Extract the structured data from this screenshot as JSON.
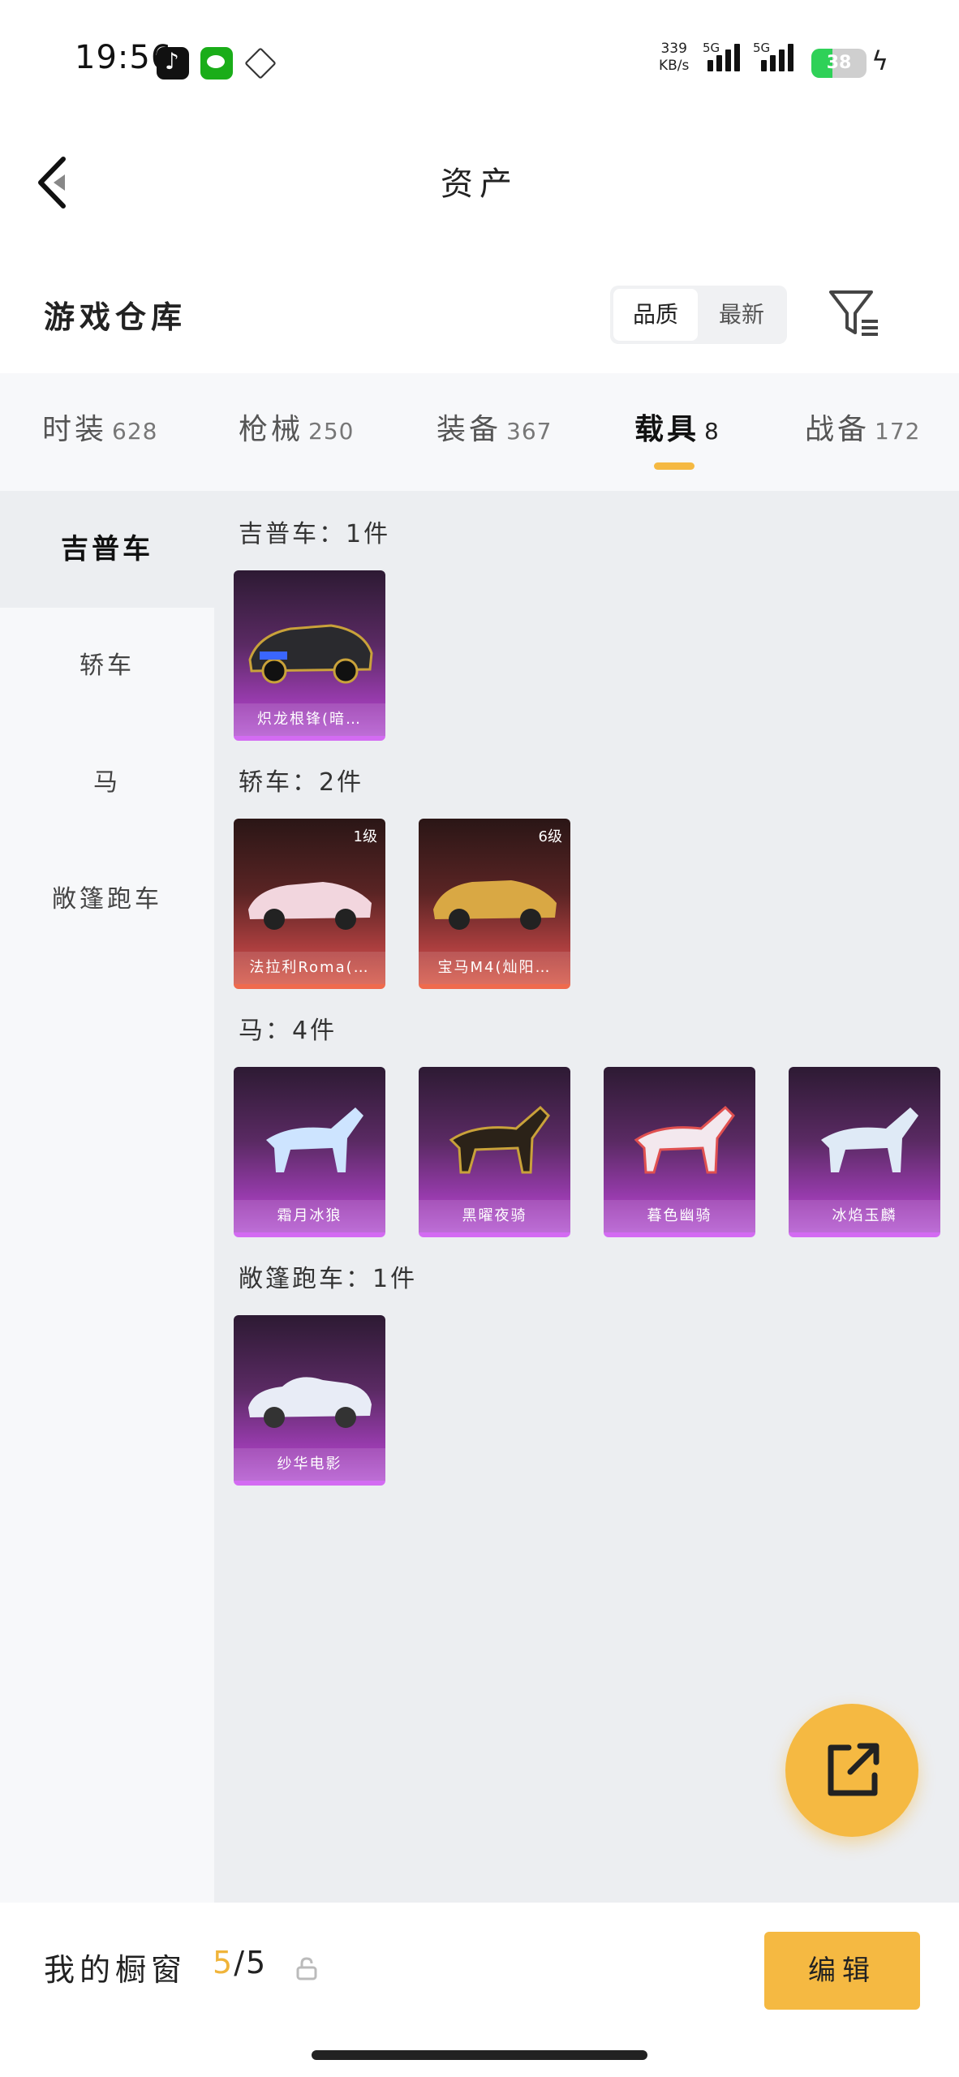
{
  "status_bar": {
    "time": "19:56",
    "net_speed_value": "339",
    "net_speed_unit": "KB/s",
    "signal1_label": "5G",
    "signal2_label": "5G",
    "battery": "38",
    "battery_level": 0.38,
    "apps": [
      "tiktok-icon",
      "wechat-icon",
      "diamond-app-icon"
    ]
  },
  "header": {
    "title": "资产",
    "back_icon": "back-arrow-icon"
  },
  "section": {
    "title": "游戏仓库",
    "sort_options": [
      "品质",
      "最新"
    ],
    "sort_selected": "品质",
    "filter_icon": "filter-icon"
  },
  "tabs": [
    {
      "label": "时装",
      "count": "628"
    },
    {
      "label": "枪械",
      "count": "250"
    },
    {
      "label": "装备",
      "count": "367"
    },
    {
      "label": "载具",
      "count": "8"
    },
    {
      "label": "战备",
      "count": "172"
    }
  ],
  "active_tab": "载具",
  "sidebar": {
    "items": [
      "吉普车",
      "轿车",
      "马",
      "敞篷跑车"
    ],
    "active": "吉普车"
  },
  "groups": [
    {
      "title": "吉普车：1件",
      "items": [
        {
          "name": "炽龙根锋(暗…",
          "level": "",
          "style": "purple"
        }
      ]
    },
    {
      "title": "轿车：2件",
      "items": [
        {
          "name": "法拉利Roma(…",
          "level": "1级",
          "style": "red"
        },
        {
          "name": "宝马M4(灿阳…",
          "level": "6级",
          "style": "red"
        }
      ]
    },
    {
      "title": "马：4件",
      "items": [
        {
          "name": "霜月冰狼",
          "level": "",
          "style": "purple"
        },
        {
          "name": "黑曜夜骑",
          "level": "",
          "style": "purple"
        },
        {
          "name": "暮色幽骑",
          "level": "",
          "style": "purple"
        },
        {
          "name": "冰焰玉麟",
          "level": "",
          "style": "purple"
        }
      ]
    },
    {
      "title": "敞篷跑车：1件",
      "items": [
        {
          "name": "纱华电影",
          "level": "",
          "style": "purple"
        }
      ]
    }
  ],
  "fab": {
    "icon": "share-icon"
  },
  "bottom_bar": {
    "label": "我的橱窗",
    "count_current": "5",
    "count_sep": "/",
    "count_total": "5",
    "lock_icon": "lock-icon",
    "edit_label": "编辑"
  },
  "colors": {
    "accent": "#f5b942",
    "purple_card": "#9a3cb0",
    "red_card": "#b04040"
  }
}
